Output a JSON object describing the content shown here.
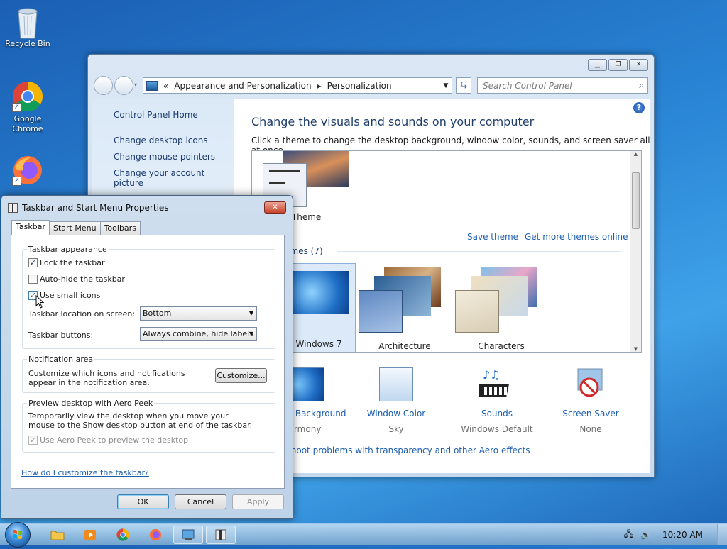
{
  "desktop": {
    "icons": [
      {
        "label": "Recycle Bin",
        "icon": "recycle-bin-icon"
      },
      {
        "label": "Google Chrome",
        "icon": "chrome-icon"
      },
      {
        "label": "Firefox",
        "icon": "firefox-icon"
      }
    ]
  },
  "control_panel": {
    "address": {
      "root": "«",
      "crumb1": "Appearance and Personalization",
      "crumb2": "Personalization"
    },
    "search_placeholder": "Search Control Panel",
    "sidebar": {
      "home": "Control Panel Home",
      "links": [
        "Change desktop icons",
        "Change mouse pointers",
        "Change your account picture"
      ]
    },
    "heading": "Change the visuals and sounds on your computer",
    "description": "Click a theme to change the desktop background, window color, sounds, and screen saver all at once.",
    "unsaved_theme_label": "Unsaved Theme",
    "save_theme": "Save theme",
    "get_more_themes": "Get more themes online",
    "aero_themes_label": "Aero Themes (7)",
    "themes": [
      "Windows 7",
      "Architecture",
      "Characters"
    ],
    "bottom": [
      {
        "title": "Desktop Background",
        "subtitle": "Harmony"
      },
      {
        "title": "Window Color",
        "subtitle": "Sky"
      },
      {
        "title": "Sounds",
        "subtitle": "Windows Default"
      },
      {
        "title": "Screen Saver",
        "subtitle": "None"
      }
    ],
    "troubleshoot": "Troubleshoot problems with transparency and other Aero effects"
  },
  "dialog": {
    "title": "Taskbar and Start Menu Properties",
    "tabs": [
      "Taskbar",
      "Start Menu",
      "Toolbars"
    ],
    "appearance": {
      "title": "Taskbar appearance",
      "lock": {
        "label": "Lock the taskbar",
        "checked": true
      },
      "autohide": {
        "label": "Auto-hide the taskbar",
        "checked": false
      },
      "small_icons": {
        "label": "Use small icons",
        "checked": true
      },
      "location_label": "Taskbar location on screen:",
      "location_value": "Bottom",
      "buttons_label": "Taskbar buttons:",
      "buttons_value": "Always combine, hide labels"
    },
    "notification": {
      "title": "Notification area",
      "text": "Customize which icons and notifications appear in the notification area.",
      "button": "Customize..."
    },
    "peek": {
      "title": "Preview desktop with Aero Peek",
      "text": "Temporarily view the desktop when you move your mouse to the Show desktop button at end of the taskbar.",
      "checkbox": "Use Aero Peek to preview the desktop"
    },
    "help_link": "How do I customize the taskbar?",
    "ok": "OK",
    "cancel": "Cancel",
    "apply": "Apply"
  },
  "taskbar": {
    "clock": "10:20 AM"
  },
  "colors": {
    "link": "#1e5fae",
    "heading": "#1e3d6b",
    "desktop": "#2a86d6"
  }
}
